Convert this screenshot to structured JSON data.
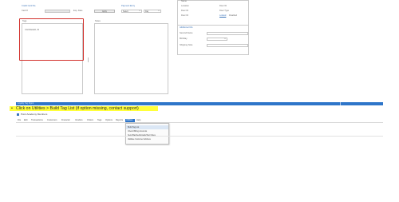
{
  "form": {
    "top_right": {
      "rows": [
        {
          "label": "Name",
          "value": ""
        },
        {
          "label": "Location",
          "value": "Door ID"
        },
        {
          "label": "Door ID",
          "value": "Door Type"
        },
        {
          "label": "Door ID",
          "value": "Locked",
          "extra": "Disabled"
        }
      ]
    },
    "credit_card": {
      "heading": "Credit Card No.",
      "card_label": "Card #",
      "exp_label": "Exp. Date",
      "button": "Apply"
    },
    "payment": {
      "heading": "Payment Entry",
      "select_a": "Select",
      "select_b": "Day"
    },
    "tags": {
      "heading": "Tags",
      "items": [
        "CANCELED, ID"
      ]
    },
    "notes": {
      "heading": "Notes"
    },
    "additional": {
      "heading": "Additional Info",
      "rows": [
        "Second Name",
        "Birthday",
        "Shipping Note"
      ]
    }
  },
  "statusbar": {
    "left": "Loyalty Tag Mgmt"
  },
  "instruction": {
    "bullet": "•",
    "text": "Click on Utilities > Build Tag List (if option missing, contact support)"
  },
  "app": {
    "title": "Point Academy Members",
    "menu": [
      "File",
      "Edit",
      "Transactions",
      "Customers",
      "Financial",
      "Vendors",
      "Orders",
      "Tags",
      "Options",
      "Reports",
      "Utilities",
      "Help"
    ],
    "active_menu_index": 10
  },
  "dropdown": {
    "items": [
      "Build Tag List",
      "Check Billing Accounts",
      "Send Batched Emails/Text Notes",
      "Validate Customer Address"
    ],
    "active_index": 0
  },
  "colors": {
    "highlight": "#ffff3a",
    "status_blue": "#2e75c9",
    "tags_outline": "#d3332e",
    "menu_active": "#2e75c9"
  }
}
